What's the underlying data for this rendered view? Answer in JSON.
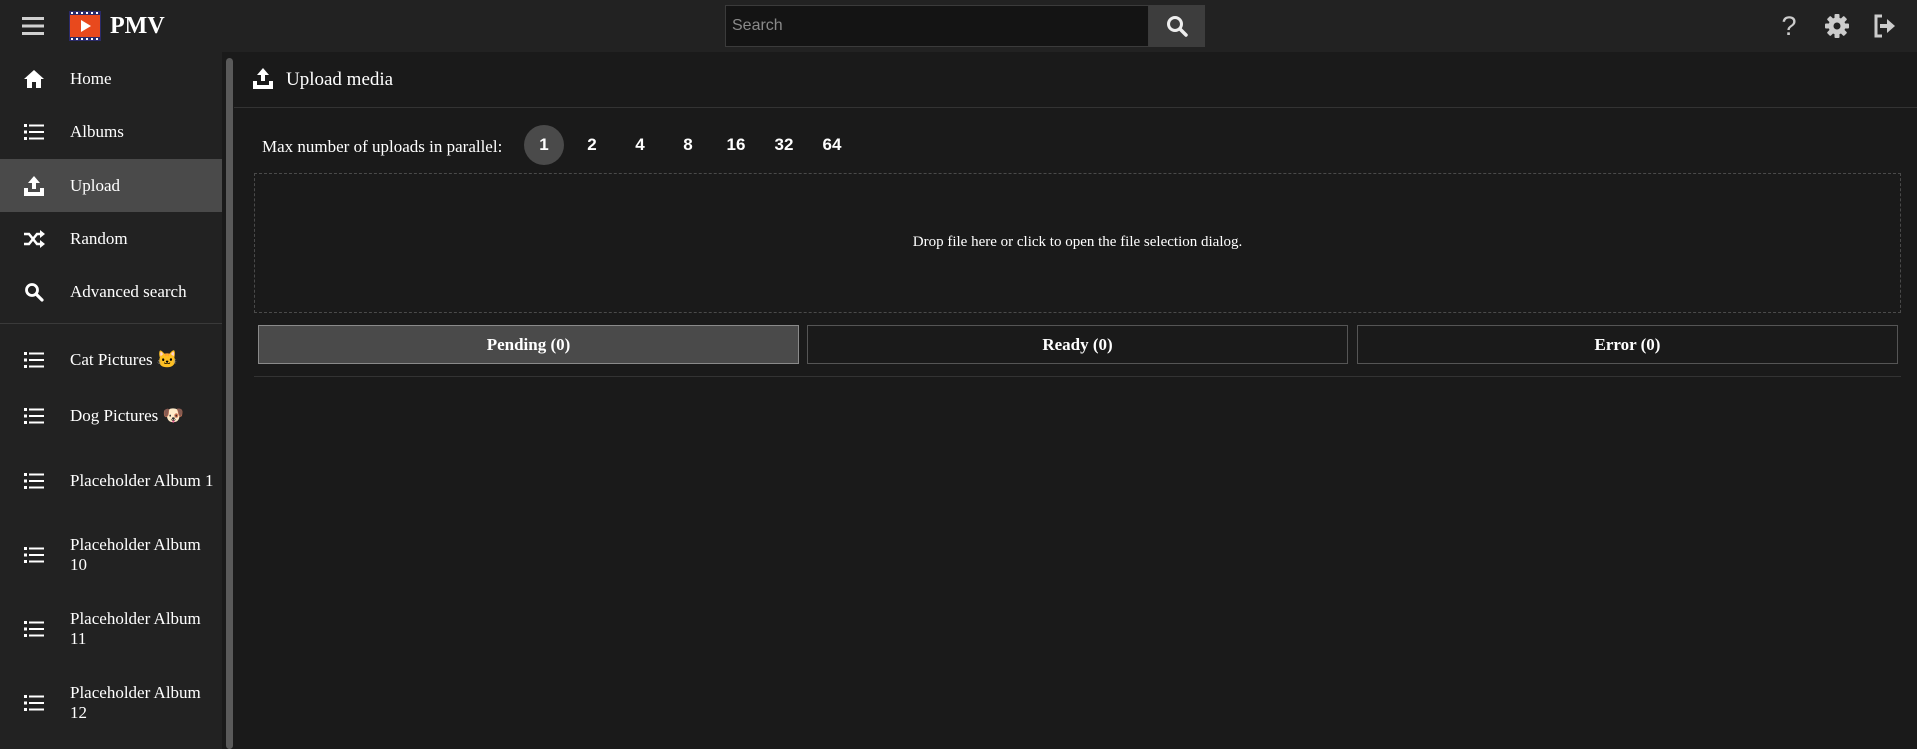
{
  "app": {
    "title": "PMV"
  },
  "search": {
    "placeholder": "Search",
    "value": ""
  },
  "sidebar": {
    "items": [
      {
        "label": "Home",
        "icon": "home-icon"
      },
      {
        "label": "Albums",
        "icon": "list-icon"
      },
      {
        "label": "Upload",
        "icon": "upload-icon",
        "active": true
      },
      {
        "label": "Random",
        "icon": "shuffle-icon"
      },
      {
        "label": "Advanced search",
        "icon": "search-icon"
      }
    ],
    "albums": [
      {
        "label": "Cat Pictures",
        "emoji": "🐱"
      },
      {
        "label": "Dog Pictures",
        "emoji": "🐶"
      },
      {
        "label": "Placeholder Album 1"
      },
      {
        "label": "Placeholder Album 10"
      },
      {
        "label": "Placeholder Album 11"
      },
      {
        "label": "Placeholder Album 12"
      }
    ]
  },
  "main": {
    "title": "Upload media",
    "parallel_label": "Max number of uploads in parallel:",
    "parallel_options": [
      "1",
      "2",
      "4",
      "8",
      "16",
      "32",
      "64"
    ],
    "parallel_selected": "1",
    "dropzone_text": "Drop file here or click to open the file selection dialog.",
    "tabs": [
      {
        "label": "Pending (0)",
        "active": true
      },
      {
        "label": "Ready (0)"
      },
      {
        "label": "Error (0)"
      }
    ]
  },
  "colors": {
    "background": "#1a1a1a",
    "bar": "#222222",
    "active": "#4a4a4a",
    "logo_accent": "#e8491d"
  }
}
